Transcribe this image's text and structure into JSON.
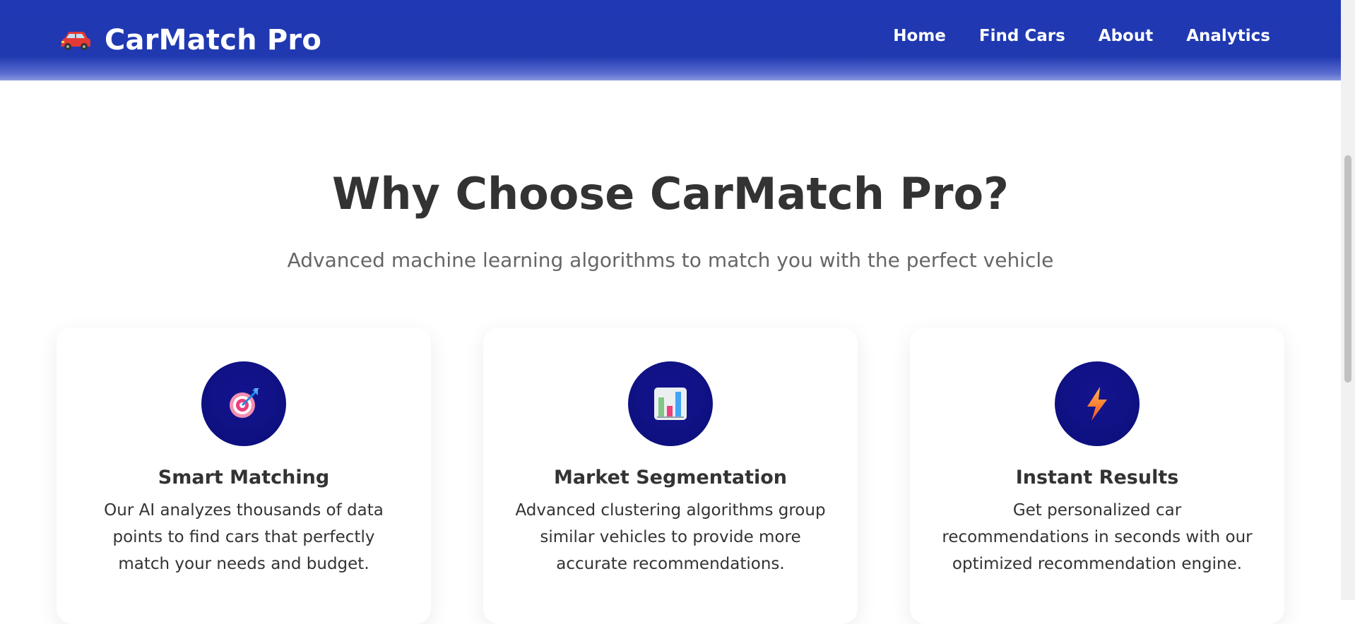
{
  "header": {
    "brand_name": "CarMatch Pro",
    "brand_icon": "car-icon",
    "nav": [
      "Home",
      "Find Cars",
      "About",
      "Analytics"
    ]
  },
  "hero": {
    "title": "Why Choose CarMatch Pro?",
    "subtitle": "Advanced machine learning algorithms to match you with the perfect vehicle"
  },
  "features": [
    {
      "icon": "target-icon",
      "title": "Smart Matching",
      "description": "Our AI analyzes thousands of data points to find cars that perfectly match your needs and budget."
    },
    {
      "icon": "bar-chart-icon",
      "title": "Market Segmentation",
      "description": "Advanced clustering algorithms group similar vehicles to provide more accurate recommendations."
    },
    {
      "icon": "lightning-icon",
      "title": "Instant Results",
      "description": "Get personalized car recommendations in seconds with our optimized recommendation engine."
    }
  ],
  "colors": {
    "header": "#2039b0",
    "icon_circle": "#0b0f7a",
    "heading_text": "#333333",
    "subtitle_text": "#666666"
  }
}
